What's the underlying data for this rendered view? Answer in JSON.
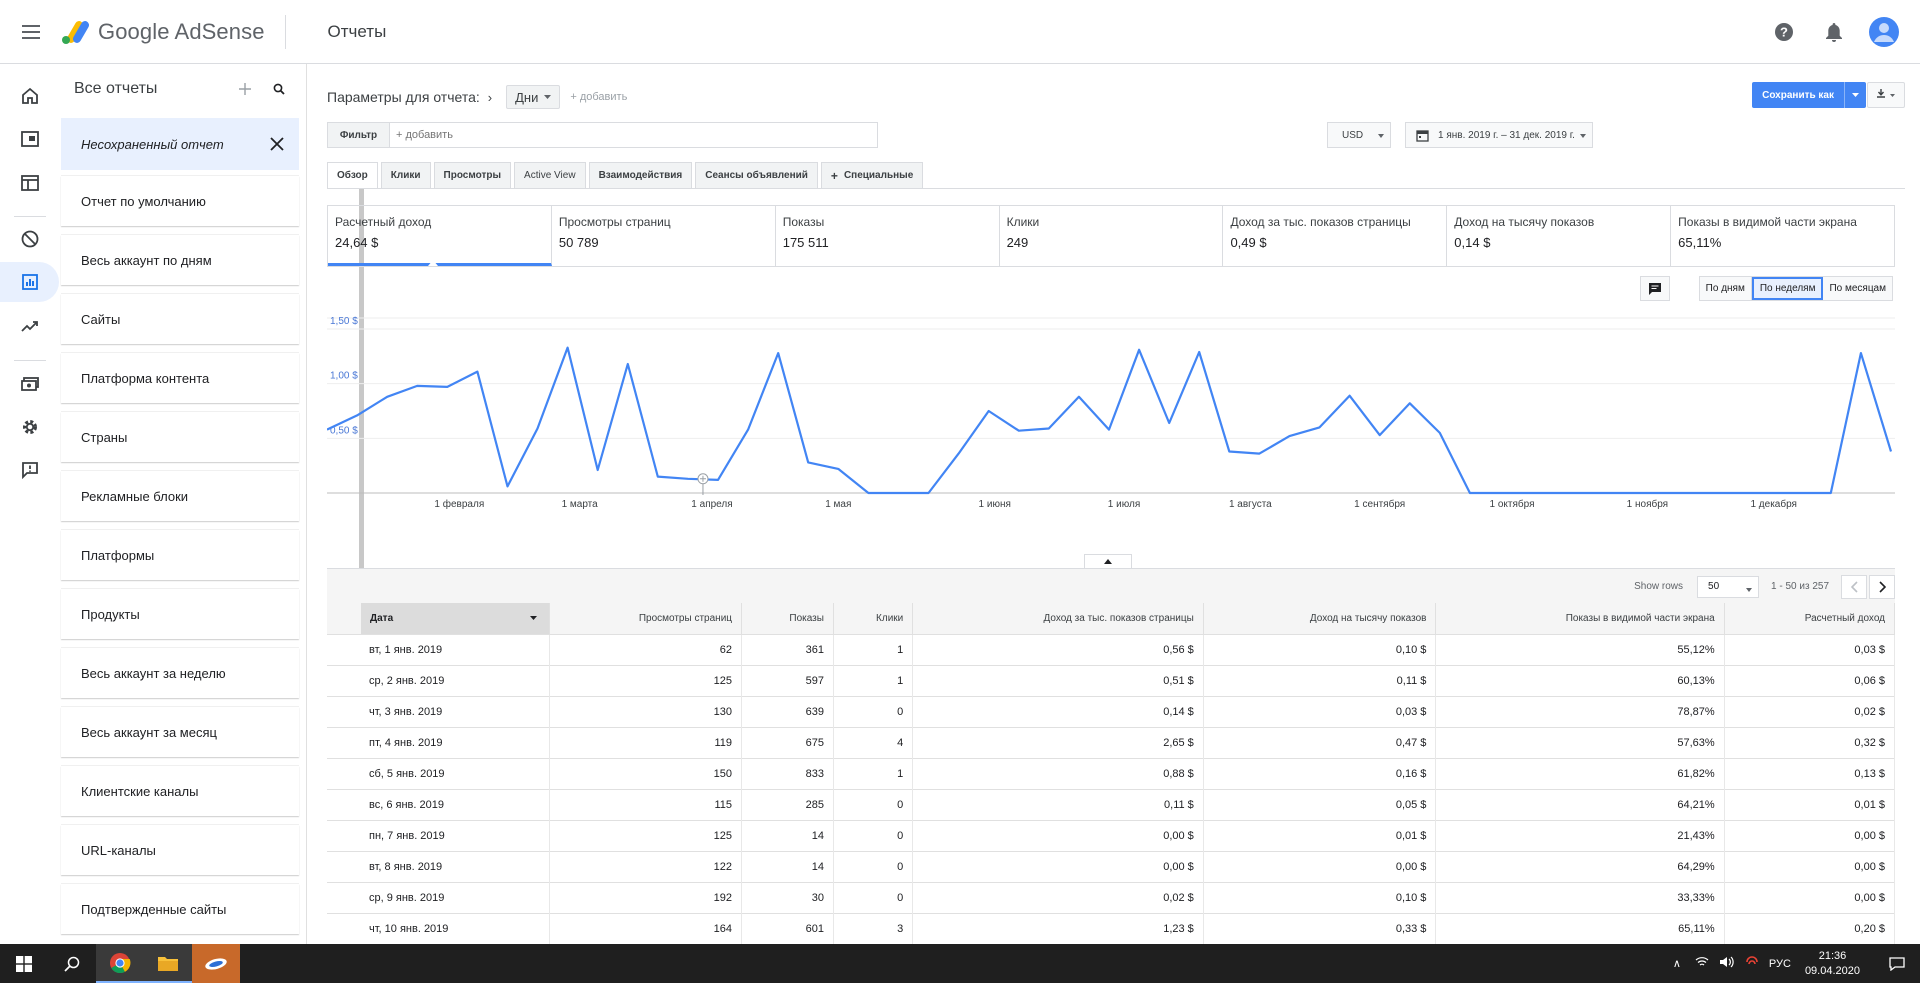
{
  "header": {
    "brand_google": "Google",
    "brand_product": "AdSense",
    "section_title": "Отчеты"
  },
  "reports_panel": {
    "title": "Все отчеты",
    "unsaved": "Несохраненный отчет",
    "items": [
      "Отчет по умолчанию",
      "Весь аккаунт по дням",
      "Сайты",
      "Платформа контента",
      "Страны",
      "Рекламные блоки",
      "Платформы",
      "Продукты",
      "Весь аккаунт за неделю",
      "Весь аккаунт за месяц",
      "Клиентские каналы",
      "URL-каналы",
      "Подтвержденные сайты"
    ]
  },
  "toolbar": {
    "params_label": "Параметры для отчета:",
    "dimension_chip": "Дни",
    "add_dimension": "+ добавить",
    "filter_label": "Фильтр",
    "filter_placeholder": "+ добавить",
    "save_label": "Сохранить как",
    "currency": "USD",
    "date_range": "1 янв. 2019 г. – 31 дек. 2019 г."
  },
  "tabs": [
    "Обзор",
    "Клики",
    "Просмотры",
    "Active View",
    "Взаимодействия",
    "Сеансы объявлений",
    "Специальные"
  ],
  "metrics": [
    {
      "label": "Расчетный доход",
      "value": "24,64 $"
    },
    {
      "label": "Просмотры страниц",
      "value": "50 789"
    },
    {
      "label": "Показы",
      "value": "175 511"
    },
    {
      "label": "Клики",
      "value": "249"
    },
    {
      "label": "Доход за тыс. показов страницы",
      "value": "0,49 $"
    },
    {
      "label": "Доход на тысячу показов",
      "value": "0,14 $"
    },
    {
      "label": "Показы в видимой части экрана",
      "value": "65,11%"
    }
  ],
  "granularity": {
    "day": "По дням",
    "week": "По неделям",
    "month": "По месяцам",
    "selected": "week"
  },
  "chart_data": {
    "type": "line",
    "y_tick_labels": [
      "1,50 $",
      "1,00 $",
      "0,50 $"
    ],
    "y_ticks": [
      1.5,
      1.0,
      0.5
    ],
    "ylim": [
      0,
      1.5
    ],
    "x_tick_labels": [
      "1 февраля",
      "1 марта",
      "1 апреля",
      "1 мая",
      "1 июня",
      "1 июля",
      "1 августа",
      "1 сентября",
      "1 октября",
      "1 ноября",
      "1 декабря"
    ],
    "x_tick_weeks": [
      4.4,
      8.4,
      12.8,
      17,
      22.2,
      26.5,
      30.7,
      35,
      39.4,
      43.9,
      48.1
    ],
    "grid": true,
    "series": [
      {
        "values": [
          0.58,
          0.71,
          0.88,
          0.98,
          0.97,
          1.11,
          0.06,
          0.59,
          1.33,
          0.21,
          1.18,
          0.15,
          0.13,
          0.12,
          0.58,
          1.28,
          0.28,
          0.22,
          0,
          0,
          0,
          0.36,
          0.75,
          0.57,
          0.59,
          0.88,
          0.58,
          1.31,
          0.64,
          1.29,
          0.38,
          0.36,
          0.52,
          0.6,
          0.89,
          0.53,
          0.82,
          0.55,
          0,
          0,
          0,
          0,
          0,
          0,
          0,
          0,
          0,
          0,
          0,
          0,
          0,
          1.28,
          0.38
        ]
      }
    ],
    "color": "#4285f4"
  },
  "table": {
    "show_rows_label": "Show rows",
    "rows_per_page": "50",
    "range_text": "1 - 50 из 257",
    "columns": [
      "Дата",
      "Просмотры страниц",
      "Показы",
      "Клики",
      "Доход за тыс. показов страницы",
      "Доход на тысячу показов",
      "Показы в видимой части экрана",
      "Расчетный доход"
    ],
    "rows": [
      [
        "вт, 1 янв. 2019",
        "62",
        "361",
        "1",
        "0,56 $",
        "0,10 $",
        "55,12%",
        "0,03 $"
      ],
      [
        "ср, 2 янв. 2019",
        "125",
        "597",
        "1",
        "0,51 $",
        "0,11 $",
        "60,13%",
        "0,06 $"
      ],
      [
        "чт, 3 янв. 2019",
        "130",
        "639",
        "0",
        "0,14 $",
        "0,03 $",
        "78,87%",
        "0,02 $"
      ],
      [
        "пт, 4 янв. 2019",
        "119",
        "675",
        "4",
        "2,65 $",
        "0,47 $",
        "57,63%",
        "0,32 $"
      ],
      [
        "сб, 5 янв. 2019",
        "150",
        "833",
        "1",
        "0,88 $",
        "0,16 $",
        "61,82%",
        "0,13 $"
      ],
      [
        "вс, 6 янв. 2019",
        "115",
        "285",
        "0",
        "0,11 $",
        "0,05 $",
        "64,21%",
        "0,01 $"
      ],
      [
        "пн, 7 янв. 2019",
        "125",
        "14",
        "0",
        "0,00 $",
        "0,01 $",
        "21,43%",
        "0,00 $"
      ],
      [
        "вт, 8 янв. 2019",
        "122",
        "14",
        "0",
        "0,00 $",
        "0,00 $",
        "64,29%",
        "0,00 $"
      ],
      [
        "ср, 9 янв. 2019",
        "192",
        "30",
        "0",
        "0,02 $",
        "0,10 $",
        "33,33%",
        "0,00 $"
      ],
      [
        "чт, 10 янв. 2019",
        "164",
        "601",
        "3",
        "1,23 $",
        "0,33 $",
        "65,11%",
        "0,20 $"
      ]
    ]
  },
  "taskbar": {
    "lang": "РУС",
    "time": "21:36",
    "date": "09.04.2020"
  }
}
